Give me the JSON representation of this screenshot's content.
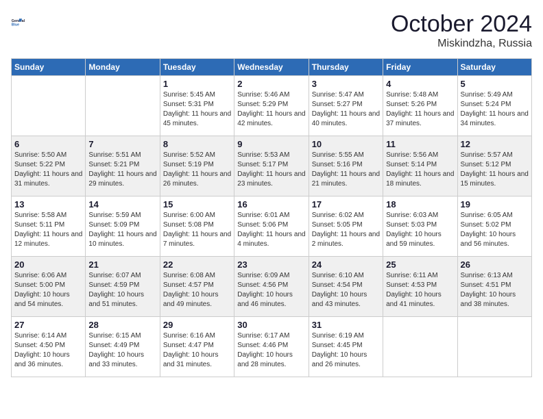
{
  "header": {
    "logo_line1": "General",
    "logo_line2": "Blue",
    "month": "October 2024",
    "location": "Miskindzha, Russia"
  },
  "weekdays": [
    "Sunday",
    "Monday",
    "Tuesday",
    "Wednesday",
    "Thursday",
    "Friday",
    "Saturday"
  ],
  "weeks": [
    [
      {
        "day": "",
        "info": ""
      },
      {
        "day": "",
        "info": ""
      },
      {
        "day": "1",
        "info": "Sunrise: 5:45 AM\nSunset: 5:31 PM\nDaylight: 11 hours and 45 minutes."
      },
      {
        "day": "2",
        "info": "Sunrise: 5:46 AM\nSunset: 5:29 PM\nDaylight: 11 hours and 42 minutes."
      },
      {
        "day": "3",
        "info": "Sunrise: 5:47 AM\nSunset: 5:27 PM\nDaylight: 11 hours and 40 minutes."
      },
      {
        "day": "4",
        "info": "Sunrise: 5:48 AM\nSunset: 5:26 PM\nDaylight: 11 hours and 37 minutes."
      },
      {
        "day": "5",
        "info": "Sunrise: 5:49 AM\nSunset: 5:24 PM\nDaylight: 11 hours and 34 minutes."
      }
    ],
    [
      {
        "day": "6",
        "info": "Sunrise: 5:50 AM\nSunset: 5:22 PM\nDaylight: 11 hours and 31 minutes."
      },
      {
        "day": "7",
        "info": "Sunrise: 5:51 AM\nSunset: 5:21 PM\nDaylight: 11 hours and 29 minutes."
      },
      {
        "day": "8",
        "info": "Sunrise: 5:52 AM\nSunset: 5:19 PM\nDaylight: 11 hours and 26 minutes."
      },
      {
        "day": "9",
        "info": "Sunrise: 5:53 AM\nSunset: 5:17 PM\nDaylight: 11 hours and 23 minutes."
      },
      {
        "day": "10",
        "info": "Sunrise: 5:55 AM\nSunset: 5:16 PM\nDaylight: 11 hours and 21 minutes."
      },
      {
        "day": "11",
        "info": "Sunrise: 5:56 AM\nSunset: 5:14 PM\nDaylight: 11 hours and 18 minutes."
      },
      {
        "day": "12",
        "info": "Sunrise: 5:57 AM\nSunset: 5:12 PM\nDaylight: 11 hours and 15 minutes."
      }
    ],
    [
      {
        "day": "13",
        "info": "Sunrise: 5:58 AM\nSunset: 5:11 PM\nDaylight: 11 hours and 12 minutes."
      },
      {
        "day": "14",
        "info": "Sunrise: 5:59 AM\nSunset: 5:09 PM\nDaylight: 11 hours and 10 minutes."
      },
      {
        "day": "15",
        "info": "Sunrise: 6:00 AM\nSunset: 5:08 PM\nDaylight: 11 hours and 7 minutes."
      },
      {
        "day": "16",
        "info": "Sunrise: 6:01 AM\nSunset: 5:06 PM\nDaylight: 11 hours and 4 minutes."
      },
      {
        "day": "17",
        "info": "Sunrise: 6:02 AM\nSunset: 5:05 PM\nDaylight: 11 hours and 2 minutes."
      },
      {
        "day": "18",
        "info": "Sunrise: 6:03 AM\nSunset: 5:03 PM\nDaylight: 10 hours and 59 minutes."
      },
      {
        "day": "19",
        "info": "Sunrise: 6:05 AM\nSunset: 5:02 PM\nDaylight: 10 hours and 56 minutes."
      }
    ],
    [
      {
        "day": "20",
        "info": "Sunrise: 6:06 AM\nSunset: 5:00 PM\nDaylight: 10 hours and 54 minutes."
      },
      {
        "day": "21",
        "info": "Sunrise: 6:07 AM\nSunset: 4:59 PM\nDaylight: 10 hours and 51 minutes."
      },
      {
        "day": "22",
        "info": "Sunrise: 6:08 AM\nSunset: 4:57 PM\nDaylight: 10 hours and 49 minutes."
      },
      {
        "day": "23",
        "info": "Sunrise: 6:09 AM\nSunset: 4:56 PM\nDaylight: 10 hours and 46 minutes."
      },
      {
        "day": "24",
        "info": "Sunrise: 6:10 AM\nSunset: 4:54 PM\nDaylight: 10 hours and 43 minutes."
      },
      {
        "day": "25",
        "info": "Sunrise: 6:11 AM\nSunset: 4:53 PM\nDaylight: 10 hours and 41 minutes."
      },
      {
        "day": "26",
        "info": "Sunrise: 6:13 AM\nSunset: 4:51 PM\nDaylight: 10 hours and 38 minutes."
      }
    ],
    [
      {
        "day": "27",
        "info": "Sunrise: 6:14 AM\nSunset: 4:50 PM\nDaylight: 10 hours and 36 minutes."
      },
      {
        "day": "28",
        "info": "Sunrise: 6:15 AM\nSunset: 4:49 PM\nDaylight: 10 hours and 33 minutes."
      },
      {
        "day": "29",
        "info": "Sunrise: 6:16 AM\nSunset: 4:47 PM\nDaylight: 10 hours and 31 minutes."
      },
      {
        "day": "30",
        "info": "Sunrise: 6:17 AM\nSunset: 4:46 PM\nDaylight: 10 hours and 28 minutes."
      },
      {
        "day": "31",
        "info": "Sunrise: 6:19 AM\nSunset: 4:45 PM\nDaylight: 10 hours and 26 minutes."
      },
      {
        "day": "",
        "info": ""
      },
      {
        "day": "",
        "info": ""
      }
    ]
  ]
}
